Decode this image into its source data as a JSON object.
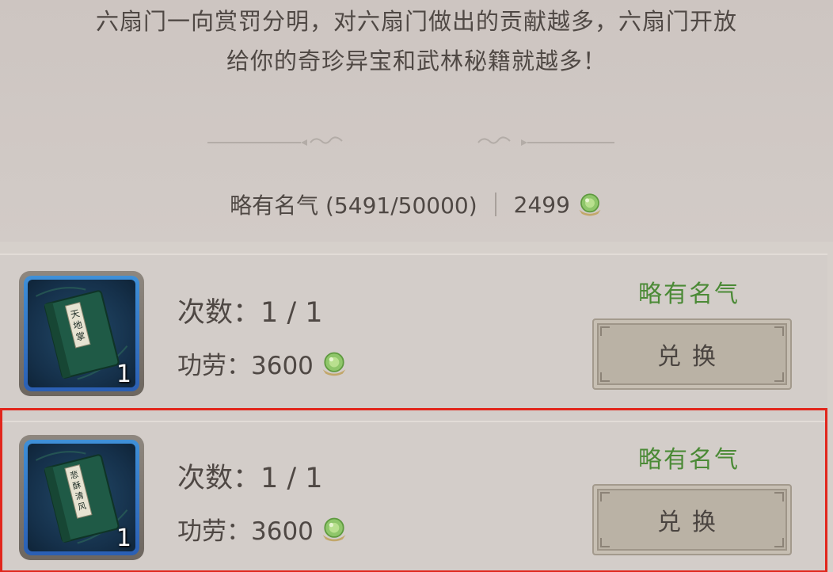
{
  "intro": {
    "line1": "六扇门一向赏罚分明，对六扇门做出的贡献越多，六扇门开放",
    "line2": "给你的奇珍异宝和武林秘籍就越多！"
  },
  "status": {
    "rank_text": "略有名气 (5491/50000)",
    "currency_amount": "2499",
    "currency_icon": "merit-coin-icon"
  },
  "items": [
    {
      "book_title": "天地掌",
      "quantity": "1",
      "count_text": "次数：1 / 1",
      "merit_text": "功劳：3600",
      "requirement": "略有名气",
      "button_label": "兑换"
    },
    {
      "book_title": "悲酥清风",
      "quantity": "1",
      "count_text": "次数：1 / 1",
      "merit_text": "功劳：3600",
      "requirement": "略有名气",
      "button_label": "兑换"
    }
  ],
  "colors": {
    "requirement_green": "#4b8a36",
    "selection_outline": "#e1261c",
    "item_frame_blue": "#3f90d8"
  }
}
